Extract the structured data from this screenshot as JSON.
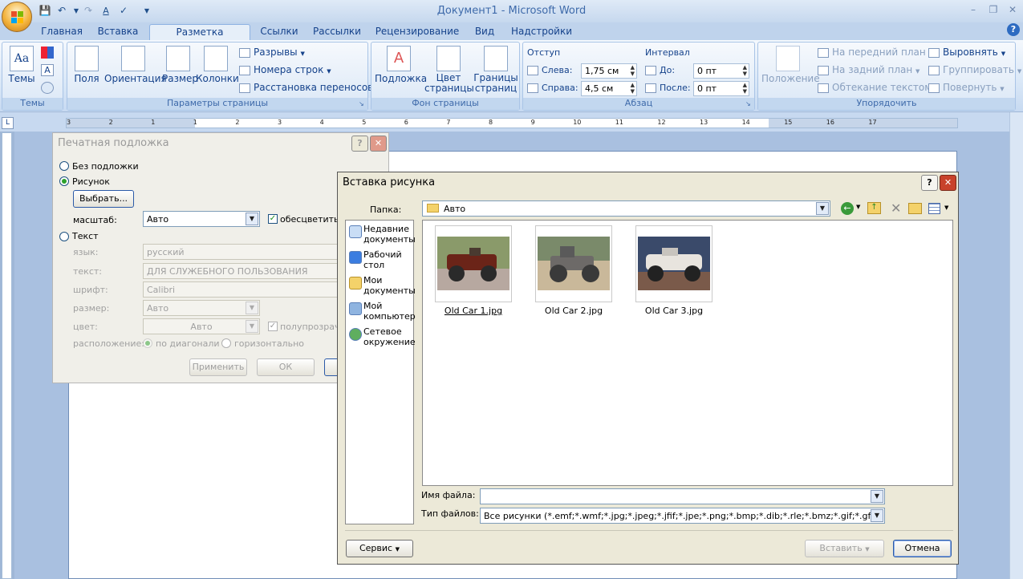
{
  "app": {
    "title": "Документ1 - Microsoft Word"
  },
  "tabs": [
    "Главная",
    "Вставка",
    "Разметка страницы",
    "Ссылки",
    "Рассылки",
    "Рецензирование",
    "Вид",
    "Надстройки"
  ],
  "ribbon": {
    "themes": {
      "label": "Темы",
      "group": "Темы"
    },
    "page_setup": {
      "group": "Параметры страницы",
      "fields": "Поля",
      "orientation": "Ориентация",
      "size": "Размер",
      "columns": "Колонки",
      "breaks": "Разрывы",
      "line_numbers": "Номера строк",
      "hyphenation": "Расстановка переносов"
    },
    "background": {
      "group": "Фон страницы",
      "watermark": "Подложка",
      "color": "Цвет",
      "color2": "страницы",
      "borders": "Границы",
      "borders2": "страниц"
    },
    "paragraph": {
      "group": "Абзац",
      "indent": "Отступ",
      "left_label": "Слева:",
      "left_value": "1,75 см",
      "right_label": "Справа:",
      "right_value": "4,5 см",
      "spacing": "Интервал",
      "before_label": "До:",
      "before_value": "0 пт",
      "after_label": "После:",
      "after_value": "0 пт"
    },
    "arrange": {
      "group": "Упорядочить",
      "position": "Положение",
      "front": "На передний план",
      "back": "На задний план",
      "wrap": "Обтекание текстом",
      "align": "Выровнять",
      "group_btn": "Группировать",
      "rotate": "Повернуть"
    }
  },
  "ruler": {
    "numbers": [
      "3",
      "2",
      "1",
      "1",
      "2",
      "3",
      "4",
      "5",
      "6",
      "7",
      "8",
      "9",
      "10",
      "11",
      "12",
      "13",
      "14",
      "15",
      "16",
      "17"
    ]
  },
  "watermark_dialog": {
    "title": "Печатная подложка",
    "no_watermark": "Без подложки",
    "picture": "Рисунок",
    "select_btn": "Выбрать...",
    "scale_label": "масштаб:",
    "scale_value": "Авто",
    "washout": "обесцветить",
    "text": "Текст",
    "language_label": "язык:",
    "language_value": "русский",
    "text_label": "текст:",
    "text_value": "ДЛЯ СЛУЖЕБНОГО ПОЛЬЗОВАНИЯ",
    "font_label": "шрифт:",
    "font_value": "Calibri",
    "size_label": "размер:",
    "size_value": "Авто",
    "color_label": "цвет:",
    "color_value": "Авто",
    "semitransparent": "полупрозрачн",
    "layout_label": "расположение:",
    "diagonal": "по диагонали",
    "horizontal": "горизонтально",
    "apply": "Применить",
    "ok": "ОК"
  },
  "insert_dialog": {
    "title": "Вставка рисунка",
    "folder_label": "Папка:",
    "folder_value": "Авто",
    "places": [
      [
        "Недавние",
        "документы"
      ],
      [
        "Рабочий",
        "стол"
      ],
      [
        "Мои",
        "документы"
      ],
      [
        "Мой",
        "компьютер"
      ],
      [
        "Сетевое",
        "окружение"
      ]
    ],
    "files": [
      "Old Car 1.jpg",
      "Old Car 2.jpg",
      "Old Car 3.jpg"
    ],
    "filename_label": "Имя файла:",
    "filename_value": "",
    "filetype_label": "Тип файлов:",
    "filetype_value": "Все рисунки (*.emf;*.wmf;*.jpg;*.jpeg;*.jfif;*.jpe;*.png;*.bmp;*.dib;*.rle;*.bmz;*.gif;*.gfa;*.em",
    "service": "Сервис",
    "insert": "Вставить",
    "cancel": "Отмена"
  }
}
